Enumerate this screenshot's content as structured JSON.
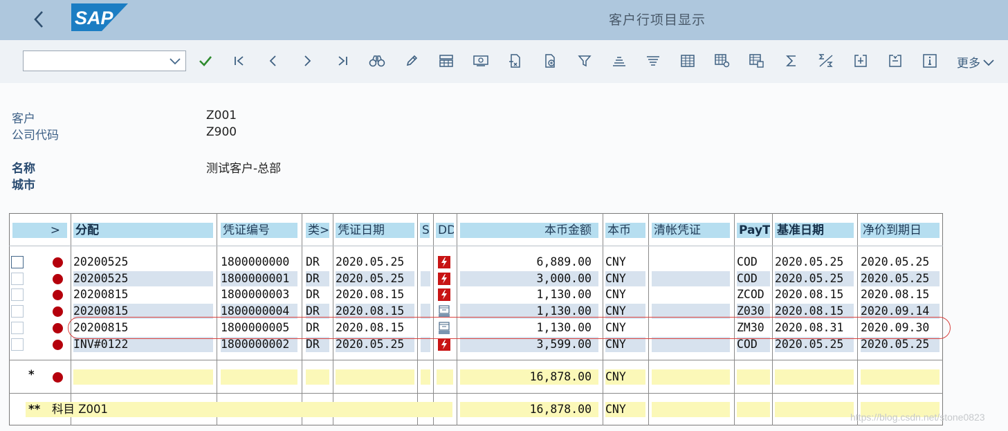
{
  "window": {
    "title": "客户行项目显示"
  },
  "toolbar": {
    "command_value": "",
    "more_label": "更多",
    "icons": [
      "check-icon",
      "first-page-icon",
      "previous-icon",
      "next-icon",
      "last-page-icon",
      "binoculars-icon",
      "pencil-icon",
      "display-layout-icon",
      "document-display-icon",
      "reverse-icon",
      "document-attach-icon",
      "filter-icon",
      "sort-ascending-icon",
      "sort-descending-icon",
      "table-icon",
      "table-settings-icon",
      "table-export-icon",
      "sum-icon",
      "subtotal-icon",
      "expand-icon",
      "collapse-icon",
      "info-icon"
    ]
  },
  "header": {
    "customer_label": "客户",
    "customer_value": "Z001",
    "company_label": "公司代码",
    "company_value": "Z900",
    "name_label": "名称",
    "name_value": "测试客户-总部",
    "city_label": "城市",
    "city_value": ""
  },
  "columns": {
    "select": ">",
    "assignment": "分配",
    "doc_no": "凭证编号",
    "type": "类>",
    "doc_date": "凭证日期",
    "s": "S",
    "dd": "DD",
    "amount": "本币金额",
    "currency": "本币",
    "clearing": "清帐凭证",
    "payt": "PayT",
    "baseline": "基准日期",
    "net_due": "净价到期日"
  },
  "rows": [
    {
      "assignment": "20200525",
      "doc_no": "1800000000",
      "type": "DR",
      "doc_date": "2020.05.25",
      "dd": "lightning",
      "amount": "6,889.00",
      "currency": "CNY",
      "clearing": "",
      "payt": "COD",
      "baseline": "2020.05.25",
      "net_due": "2020.05.25"
    },
    {
      "assignment": "20200525",
      "doc_no": "1800000001",
      "type": "DR",
      "doc_date": "2020.05.25",
      "dd": "lightning",
      "amount": "3,000.00",
      "currency": "CNY",
      "clearing": "",
      "payt": "COD",
      "baseline": "2020.05.25",
      "net_due": "2020.05.25"
    },
    {
      "assignment": "20200815",
      "doc_no": "1800000003",
      "type": "DR",
      "doc_date": "2020.08.15",
      "dd": "lightning",
      "amount": "1,130.00",
      "currency": "CNY",
      "clearing": "",
      "payt": "ZCOD",
      "baseline": "2020.08.15",
      "net_due": "2020.08.15"
    },
    {
      "assignment": "20200815",
      "doc_no": "1800000004",
      "type": "DR",
      "doc_date": "2020.08.15",
      "dd": "calendar",
      "amount": "1,130.00",
      "currency": "CNY",
      "clearing": "",
      "payt": "Z030",
      "baseline": "2020.08.15",
      "net_due": "2020.09.14"
    },
    {
      "assignment": "20200815",
      "doc_no": "1800000005",
      "type": "DR",
      "doc_date": "2020.08.15",
      "dd": "calendar",
      "amount": "1,130.00",
      "currency": "CNY",
      "clearing": "",
      "payt": "ZM30",
      "baseline": "2020.08.31",
      "net_due": "2020.09.30"
    },
    {
      "assignment": "INV#0122",
      "doc_no": "1800000002",
      "type": "DR",
      "doc_date": "2020.05.25",
      "dd": "lightning",
      "amount": "3,599.00",
      "currency": "CNY",
      "clearing": "",
      "payt": "COD",
      "baseline": "2020.05.25",
      "net_due": "2020.05.25"
    }
  ],
  "subtotal": {
    "marker": "*",
    "amount": "16,878.00",
    "currency": "CNY"
  },
  "total": {
    "marker": "**",
    "label": "科目 Z001",
    "amount": "16,878.00",
    "currency": "CNY"
  },
  "watermark": "https://blog.csdn.net/stone0823",
  "colors": {
    "titlebar": "#aec7dd",
    "toolbar": "#eef2f6",
    "column_header": "#b6def0",
    "row_alt": "#d7e2ee",
    "total_row": "#fbf8b8",
    "status_red": "#b5000c",
    "highlight": "#d9413e",
    "sap_blue": "#1b7dc3"
  }
}
